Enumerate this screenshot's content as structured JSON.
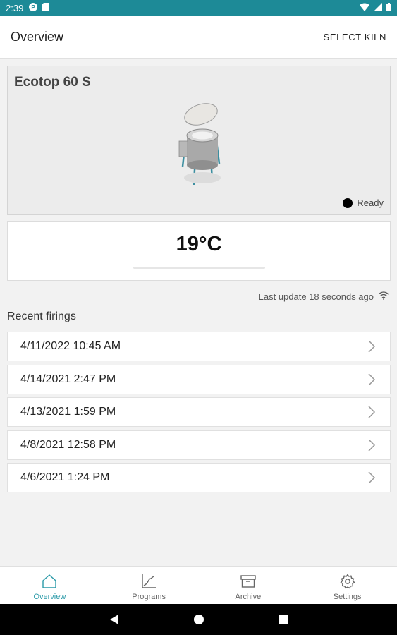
{
  "status_bar": {
    "time": "2:39"
  },
  "app_bar": {
    "title": "Overview",
    "action": "SELECT KILN"
  },
  "kiln": {
    "name": "Ecotop 60 S",
    "status": "Ready"
  },
  "temperature": {
    "value": "19°C"
  },
  "last_update": "Last update 18 seconds ago",
  "recent_firings": {
    "title": "Recent firings",
    "items": [
      {
        "label": "4/11/2022 10:45 AM"
      },
      {
        "label": "4/14/2021 2:47 PM"
      },
      {
        "label": "4/13/2021 1:59 PM"
      },
      {
        "label": "4/8/2021 12:58 PM"
      },
      {
        "label": "4/6/2021 1:24 PM"
      }
    ]
  },
  "bottom_nav": {
    "items": [
      {
        "label": "Overview",
        "icon": "home-icon",
        "active": true
      },
      {
        "label": "Programs",
        "icon": "chart-icon",
        "active": false
      },
      {
        "label": "Archive",
        "icon": "archive-icon",
        "active": false
      },
      {
        "label": "Settings",
        "icon": "gear-icon",
        "active": false
      }
    ]
  },
  "colors": {
    "status_bar": "#1d8a97",
    "accent": "#2a9aa8"
  }
}
